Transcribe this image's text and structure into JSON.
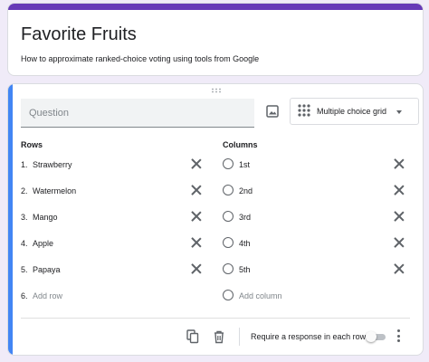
{
  "form": {
    "title": "Favorite Fruits",
    "description": "How to approximate ranked-choice voting using tools from Google"
  },
  "question": {
    "placeholder": "Question",
    "type": "Multiple choice grid",
    "rows_heading": "Rows",
    "columns_heading": "Columns",
    "rows": [
      {
        "num": "1.",
        "label": "Strawberry"
      },
      {
        "num": "2.",
        "label": "Watermelon"
      },
      {
        "num": "3.",
        "label": "Mango"
      },
      {
        "num": "4.",
        "label": "Apple"
      },
      {
        "num": "5.",
        "label": "Papaya"
      }
    ],
    "add_row": {
      "num": "6.",
      "label": "Add row"
    },
    "columns": [
      "1st",
      "2nd",
      "3rd",
      "4th",
      "5th"
    ],
    "add_column": "Add column"
  },
  "footer": {
    "require_label": "Require a response in each row",
    "require_enabled": false
  },
  "colors": {
    "accent_purple": "#673ab7",
    "active_blue": "#4285f4",
    "background": "#f0ebf8"
  },
  "icons": [
    "drag-handle-icon",
    "image-icon",
    "grid-icon",
    "close-icon",
    "copy-icon",
    "trash-icon",
    "more-vert-icon"
  ]
}
